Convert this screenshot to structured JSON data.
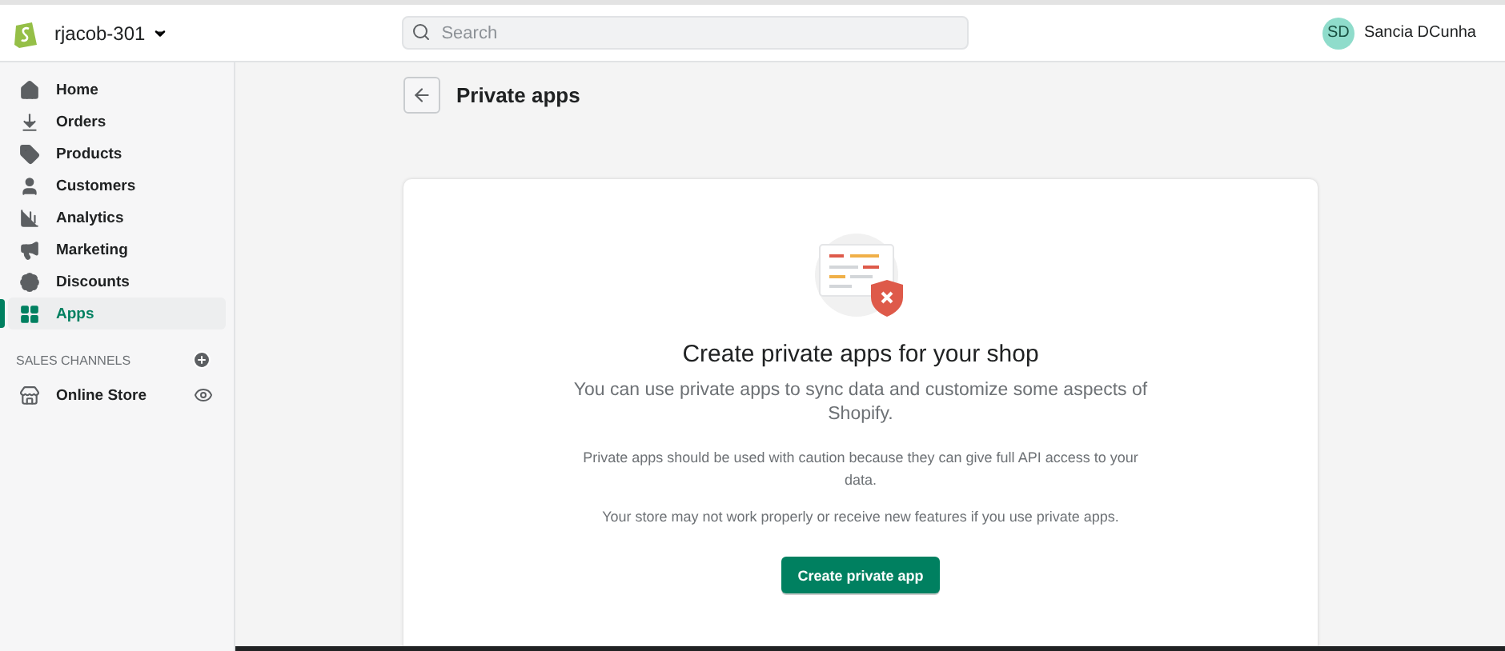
{
  "topbar": {
    "store_name": "rjacob-301",
    "search": {
      "placeholder": "Search"
    },
    "user": {
      "initials": "SD",
      "name": "Sancia DCunha"
    }
  },
  "sidebar": {
    "items": [
      {
        "label": "Home",
        "selected": false
      },
      {
        "label": "Orders",
        "selected": false
      },
      {
        "label": "Products",
        "selected": false
      },
      {
        "label": "Customers",
        "selected": false
      },
      {
        "label": "Analytics",
        "selected": false
      },
      {
        "label": "Marketing",
        "selected": false
      },
      {
        "label": "Discounts",
        "selected": false
      },
      {
        "label": "Apps",
        "selected": true
      }
    ],
    "sales_channels": {
      "heading": "SALES CHANNELS",
      "items": [
        {
          "label": "Online Store"
        }
      ]
    }
  },
  "page": {
    "title": "Private apps"
  },
  "empty_state": {
    "heading": "Create private apps for your shop",
    "description": "You can use private apps to sync data and customize some aspects of Shopify.",
    "notes": [
      "Private apps should be used with caution because they can give full API access to your data.",
      "Your store may not work properly or receive new features if you use private apps."
    ],
    "button": "Create private app"
  }
}
